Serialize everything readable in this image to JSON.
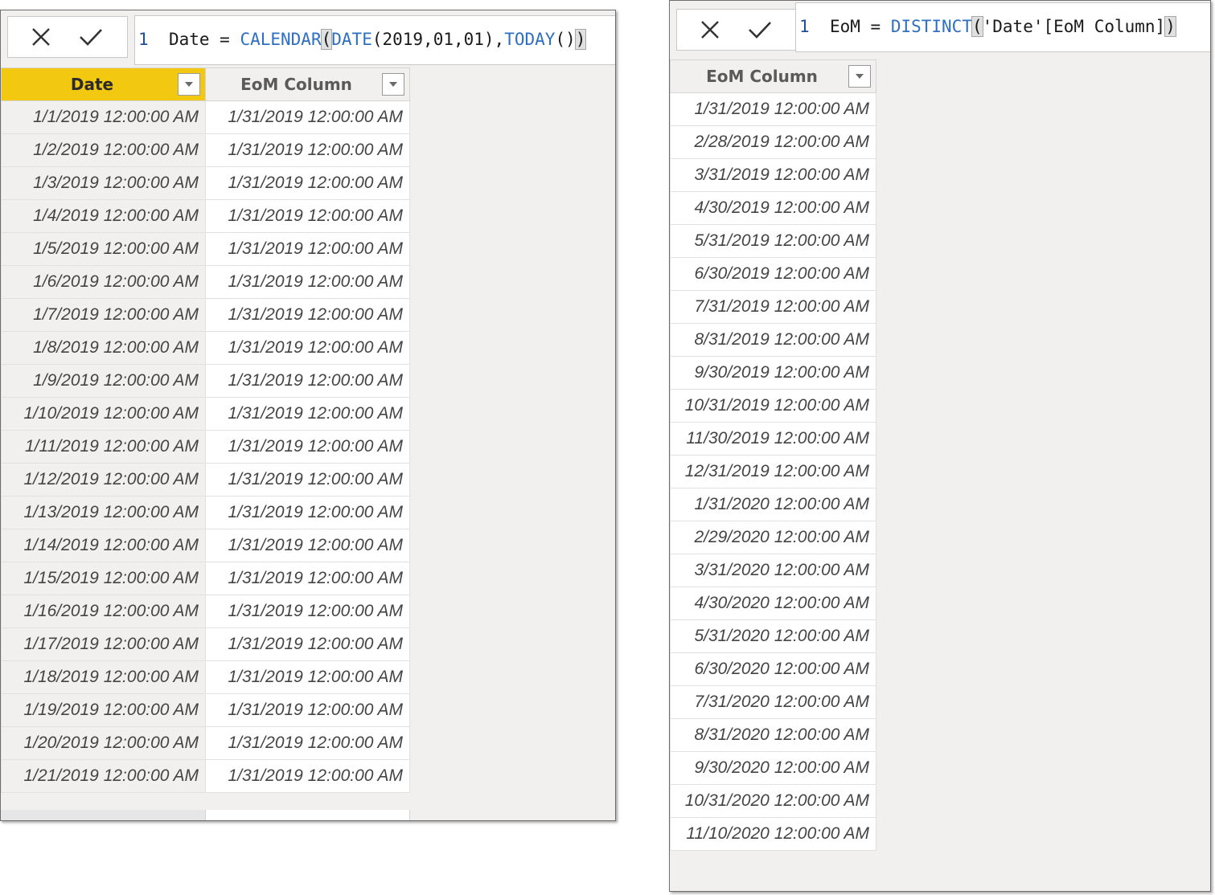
{
  "left": {
    "formula": {
      "line_number": "1",
      "tokens": [
        {
          "text": "  Date = ",
          "cls": ""
        },
        {
          "text": "CALENDAR",
          "cls": "kw"
        },
        {
          "text": "(",
          "cls": "br"
        },
        {
          "text": "DATE",
          "cls": "kw"
        },
        {
          "text": "(2019,01,01),",
          "cls": ""
        },
        {
          "text": "TODAY",
          "cls": "kw"
        },
        {
          "text": "()",
          "cls": ""
        },
        {
          "text": ")",
          "cls": "br"
        }
      ]
    },
    "columns": [
      "Date",
      "EoM Column"
    ],
    "rows": [
      [
        "1/1/2019 12:00:00 AM",
        "1/31/2019 12:00:00 AM"
      ],
      [
        "1/2/2019 12:00:00 AM",
        "1/31/2019 12:00:00 AM"
      ],
      [
        "1/3/2019 12:00:00 AM",
        "1/31/2019 12:00:00 AM"
      ],
      [
        "1/4/2019 12:00:00 AM",
        "1/31/2019 12:00:00 AM"
      ],
      [
        "1/5/2019 12:00:00 AM",
        "1/31/2019 12:00:00 AM"
      ],
      [
        "1/6/2019 12:00:00 AM",
        "1/31/2019 12:00:00 AM"
      ],
      [
        "1/7/2019 12:00:00 AM",
        "1/31/2019 12:00:00 AM"
      ],
      [
        "1/8/2019 12:00:00 AM",
        "1/31/2019 12:00:00 AM"
      ],
      [
        "1/9/2019 12:00:00 AM",
        "1/31/2019 12:00:00 AM"
      ],
      [
        "1/10/2019 12:00:00 AM",
        "1/31/2019 12:00:00 AM"
      ],
      [
        "1/11/2019 12:00:00 AM",
        "1/31/2019 12:00:00 AM"
      ],
      [
        "1/12/2019 12:00:00 AM",
        "1/31/2019 12:00:00 AM"
      ],
      [
        "1/13/2019 12:00:00 AM",
        "1/31/2019 12:00:00 AM"
      ],
      [
        "1/14/2019 12:00:00 AM",
        "1/31/2019 12:00:00 AM"
      ],
      [
        "1/15/2019 12:00:00 AM",
        "1/31/2019 12:00:00 AM"
      ],
      [
        "1/16/2019 12:00:00 AM",
        "1/31/2019 12:00:00 AM"
      ],
      [
        "1/17/2019 12:00:00 AM",
        "1/31/2019 12:00:00 AM"
      ],
      [
        "1/18/2019 12:00:00 AM",
        "1/31/2019 12:00:00 AM"
      ],
      [
        "1/19/2019 12:00:00 AM",
        "1/31/2019 12:00:00 AM"
      ],
      [
        "1/20/2019 12:00:00 AM",
        "1/31/2019 12:00:00 AM"
      ],
      [
        "1/21/2019 12:00:00 AM",
        "1/31/2019 12:00:00 AM"
      ]
    ]
  },
  "right": {
    "formula": {
      "line_number": "1",
      "tokens": [
        {
          "text": "  EoM = ",
          "cls": ""
        },
        {
          "text": "DISTINCT",
          "cls": "kw"
        },
        {
          "text": "(",
          "cls": "br"
        },
        {
          "text": "'Date'[EoM Column]",
          "cls": ""
        },
        {
          "text": ")",
          "cls": "br"
        }
      ]
    },
    "columns": [
      "EoM Column"
    ],
    "rows": [
      [
        "1/31/2019 12:00:00 AM"
      ],
      [
        "2/28/2019 12:00:00 AM"
      ],
      [
        "3/31/2019 12:00:00 AM"
      ],
      [
        "4/30/2019 12:00:00 AM"
      ],
      [
        "5/31/2019 12:00:00 AM"
      ],
      [
        "6/30/2019 12:00:00 AM"
      ],
      [
        "7/31/2019 12:00:00 AM"
      ],
      [
        "8/31/2019 12:00:00 AM"
      ],
      [
        "9/30/2019 12:00:00 AM"
      ],
      [
        "10/31/2019 12:00:00 AM"
      ],
      [
        "11/30/2019 12:00:00 AM"
      ],
      [
        "12/31/2019 12:00:00 AM"
      ],
      [
        "1/31/2020 12:00:00 AM"
      ],
      [
        "2/29/2020 12:00:00 AM"
      ],
      [
        "3/31/2020 12:00:00 AM"
      ],
      [
        "4/30/2020 12:00:00 AM"
      ],
      [
        "5/31/2020 12:00:00 AM"
      ],
      [
        "6/30/2020 12:00:00 AM"
      ],
      [
        "7/31/2020 12:00:00 AM"
      ],
      [
        "8/31/2020 12:00:00 AM"
      ],
      [
        "9/30/2020 12:00:00 AM"
      ],
      [
        "10/31/2020 12:00:00 AM"
      ],
      [
        "11/10/2020 12:00:00 AM"
      ]
    ]
  },
  "icons": {
    "cancel": "close-icon",
    "commit": "checkmark-icon"
  },
  "colors": {
    "selected_header": "#f2c811",
    "keyword": "#2e6fc2",
    "panel_bg": "#f1f0ef"
  }
}
